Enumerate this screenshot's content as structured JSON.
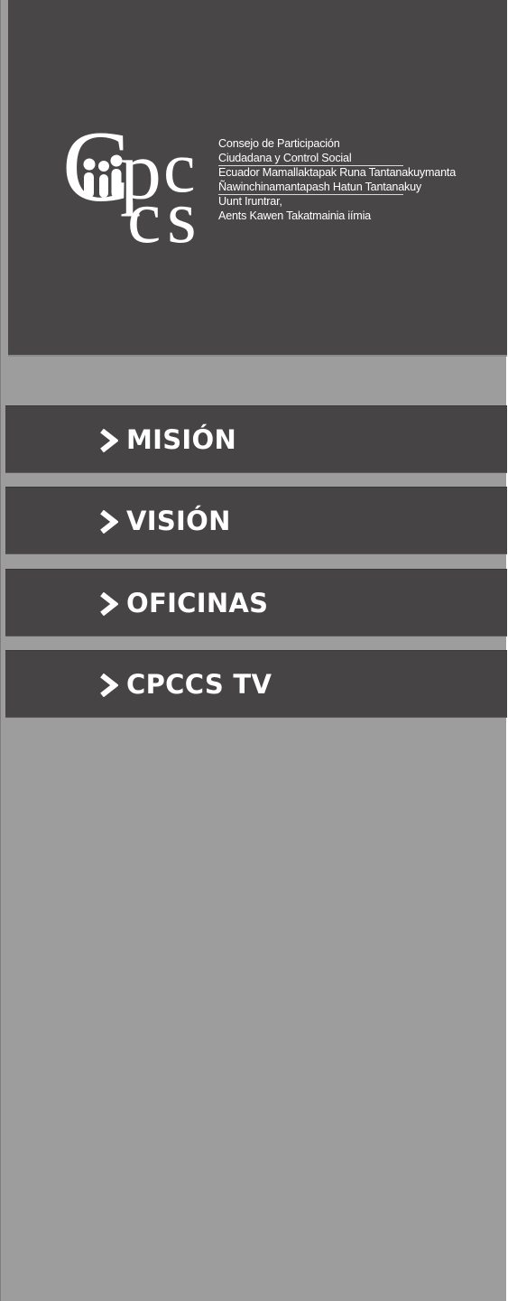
{
  "logo": {
    "mark_letters": [
      "C",
      "p",
      "c",
      "c",
      "s"
    ],
    "text_lines": [
      "Consejo de Participación",
      "Ciudadana y Control Social",
      "Ecuador Mamallaktapak Runa Tantanakuymanta",
      "Ñawinchinamantapash Hatun Tantanakuy",
      "Uunt Iruntrar,",
      "Aents Kawen Takatmainia iímia"
    ]
  },
  "menu": {
    "items": [
      {
        "label": "MISIÓN",
        "icon": "chevron-right-icon"
      },
      {
        "label": "VISIÓN",
        "icon": "chevron-right-icon"
      },
      {
        "label": "OFICINAS",
        "icon": "chevron-right-icon"
      },
      {
        "label": "CPCCS TV",
        "icon": "chevron-right-icon"
      }
    ]
  },
  "colors": {
    "sidebar_bg": "#9d9d9d",
    "header_bg": "#484646",
    "menu_item_bg": "#464444",
    "text": "#ffffff"
  }
}
